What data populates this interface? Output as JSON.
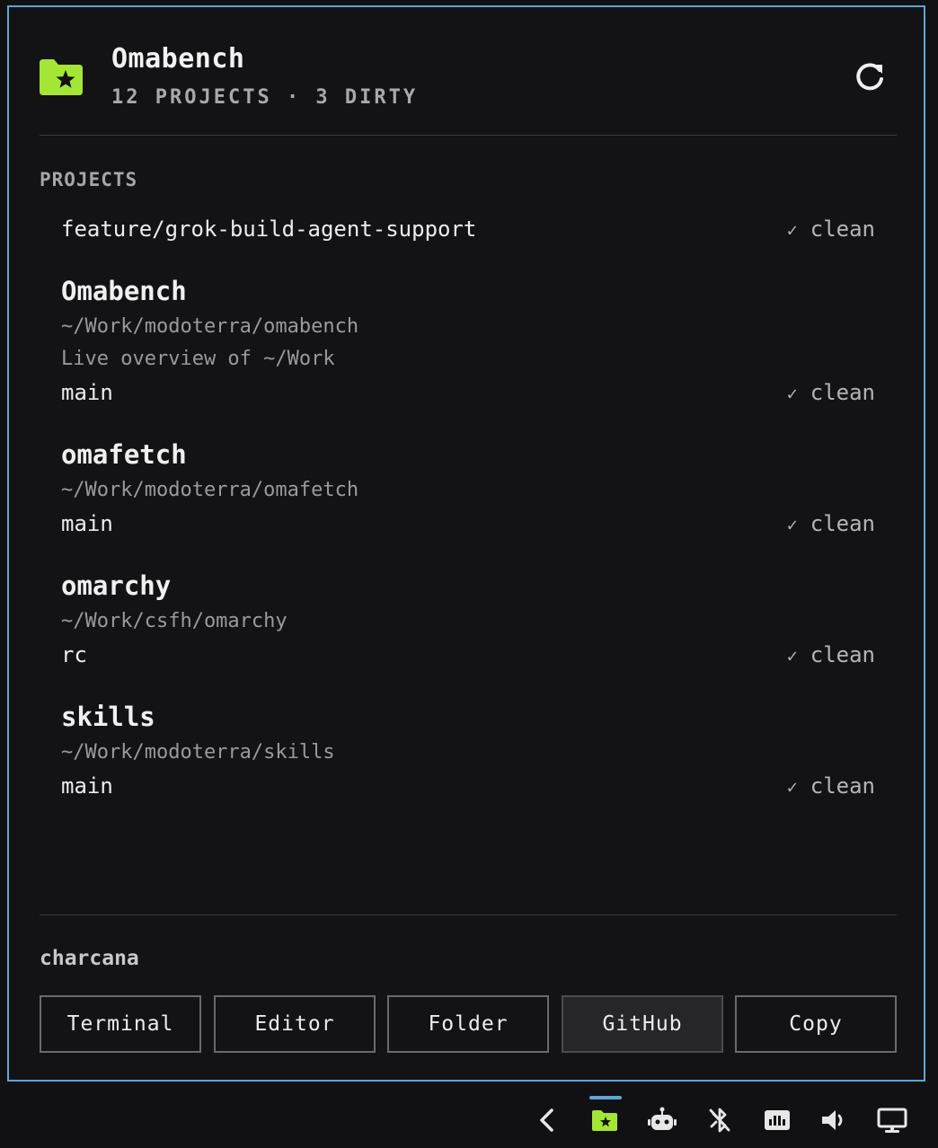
{
  "app": {
    "title": "Omabench",
    "subtitle": "12 PROJECTS · 3 DIRTY"
  },
  "colors": {
    "accent": "#a3e635",
    "border": "#5aa7d6"
  },
  "projects_label": "PROJECTS",
  "projects": [
    {
      "name": "",
      "path": "",
      "description": "",
      "branch": "feature/grok-build-agent-support",
      "status": "clean"
    },
    {
      "name": "Omabench",
      "path": "~/Work/modoterra/omabench",
      "description": "Live overview of ~/Work",
      "branch": "main",
      "status": "clean"
    },
    {
      "name": "omafetch",
      "path": "~/Work/modoterra/omafetch",
      "description": "",
      "branch": "main",
      "status": "clean"
    },
    {
      "name": "omarchy",
      "path": "~/Work/csfh/omarchy",
      "description": "",
      "branch": "rc",
      "status": "clean"
    },
    {
      "name": "skills",
      "path": "~/Work/modoterra/skills",
      "description": "",
      "branch": "main",
      "status": "clean"
    }
  ],
  "status_check": "✓",
  "selected_project": "charcana",
  "actions": [
    "Terminal",
    "Editor",
    "Folder",
    "GitHub",
    "Copy"
  ],
  "active_action": "GitHub",
  "tray_icons": [
    "chevron-left-icon",
    "folder-star-icon",
    "robot-icon",
    "bluetooth-off-icon",
    "network-icon",
    "volume-icon",
    "monitor-icon"
  ]
}
